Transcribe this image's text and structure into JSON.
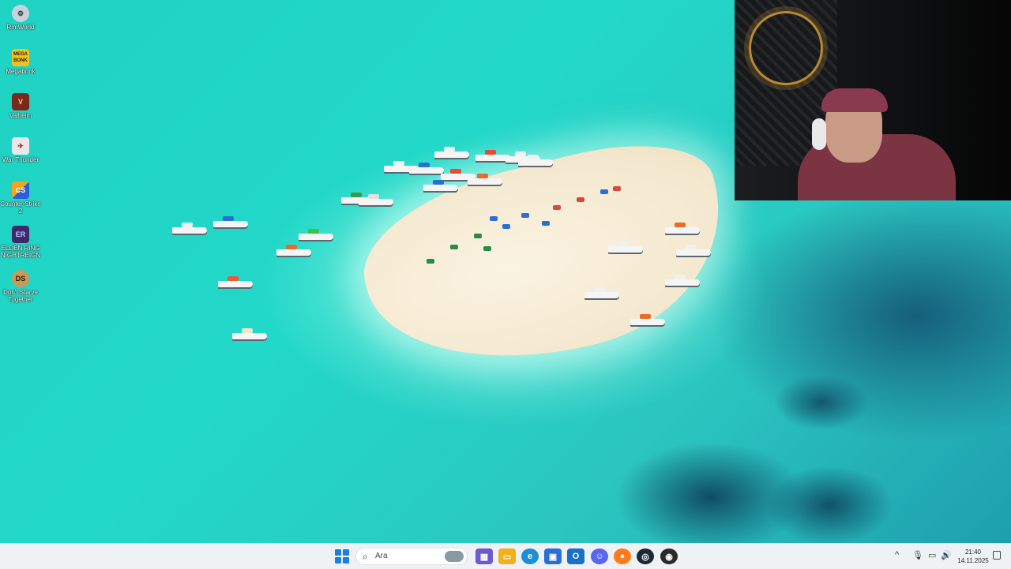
{
  "desktop": {
    "icons": [
      {
        "label": "RimWorld",
        "glyph": "⚙"
      },
      {
        "label": "Megabonk",
        "glyph": "MEGA BONK"
      },
      {
        "label": "Valheim",
        "glyph": "V"
      },
      {
        "label": "War Thunder",
        "glyph": "✈"
      },
      {
        "label": "Counter-Strike 2",
        "glyph": "CS"
      },
      {
        "label": "ELDEN RING NIGHTREIGN",
        "glyph": "ER"
      },
      {
        "label": "Don't Starve Together",
        "glyph": "DS"
      }
    ]
  },
  "taskbar": {
    "start_icon": "windows-start-icon",
    "search": {
      "placeholder": "Ara",
      "icon": "search-icon"
    },
    "apps": [
      {
        "name": "news-widget-icon",
        "color": "#6a5acd"
      },
      {
        "name": "file-explorer-icon",
        "color": "#f2b01e"
      },
      {
        "name": "edge-icon",
        "color": "#1d8fd6"
      },
      {
        "name": "microsoft-store-icon",
        "color": "#2b6fd6"
      },
      {
        "name": "outlook-icon",
        "color": "#1a6fc7"
      },
      {
        "name": "discord-icon",
        "color": "#5865f2"
      },
      {
        "name": "firefox-icon",
        "color": "#ff7a1a"
      },
      {
        "name": "steam-icon",
        "color": "#1b2838"
      },
      {
        "name": "recording-app-icon",
        "color": "#2a2a2a"
      }
    ],
    "tray": {
      "chevron": "^",
      "mic_icon": "microphone-icon",
      "network_icon": "network-icon",
      "volume_icon": "volume-icon",
      "time": "21:40",
      "date": "14.11.2025"
    }
  }
}
